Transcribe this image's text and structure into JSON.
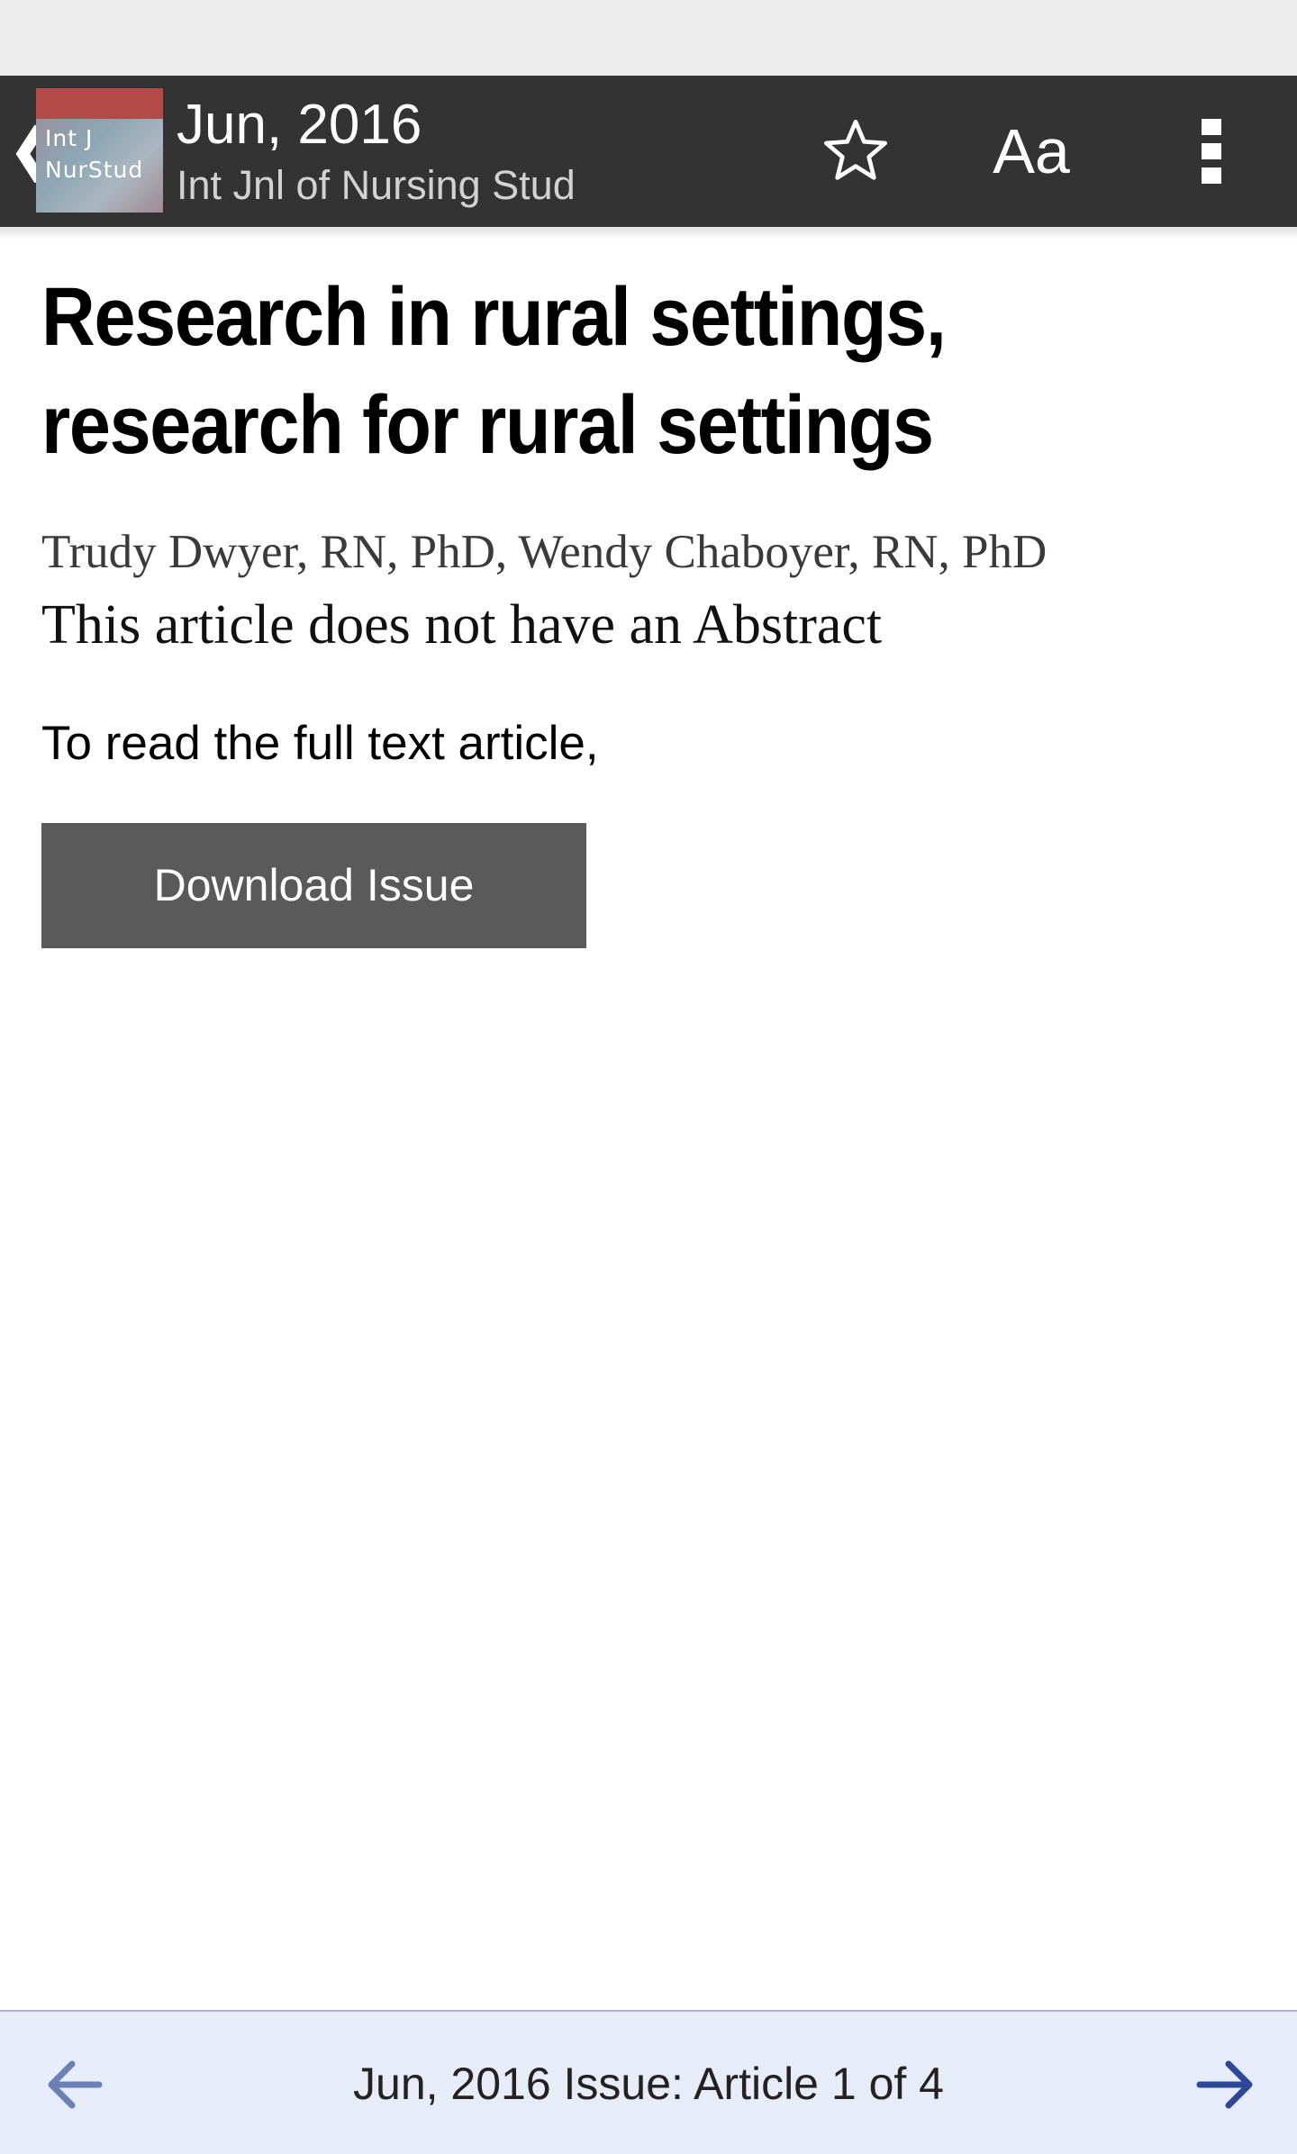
{
  "header": {
    "thumbnail_text": "Int J\nNurStud",
    "issue_date": "Jun, 2016",
    "journal": "Int Jnl of Nursing Stud",
    "font_size_label": "Aa",
    "icons": {
      "back": "chevron-left-icon",
      "bookmark": "star-outline-icon",
      "menu": "more-vertical-icon"
    }
  },
  "article": {
    "title": "Research in rural settings, research for rural settings",
    "authors": "Trudy Dwyer, RN, PhD, Wendy Chaboyer, RN, PhD",
    "abstract_note": "This article does not have an Abstract",
    "read_prompt": "To read the full text article,",
    "download_label": "Download Issue"
  },
  "footer": {
    "status": "Jun, 2016 Issue: Article 1 of 4",
    "icons": {
      "previous": "arrow-left-icon",
      "next": "arrow-right-icon"
    }
  },
  "colors": {
    "app_bar": "#333333",
    "button": "#5a5a5a",
    "footer_bg": "#e6ecf8",
    "arrow_prev": "#6b80b6",
    "arrow_next": "#2e4796",
    "thumb_band": "#b24a48"
  }
}
